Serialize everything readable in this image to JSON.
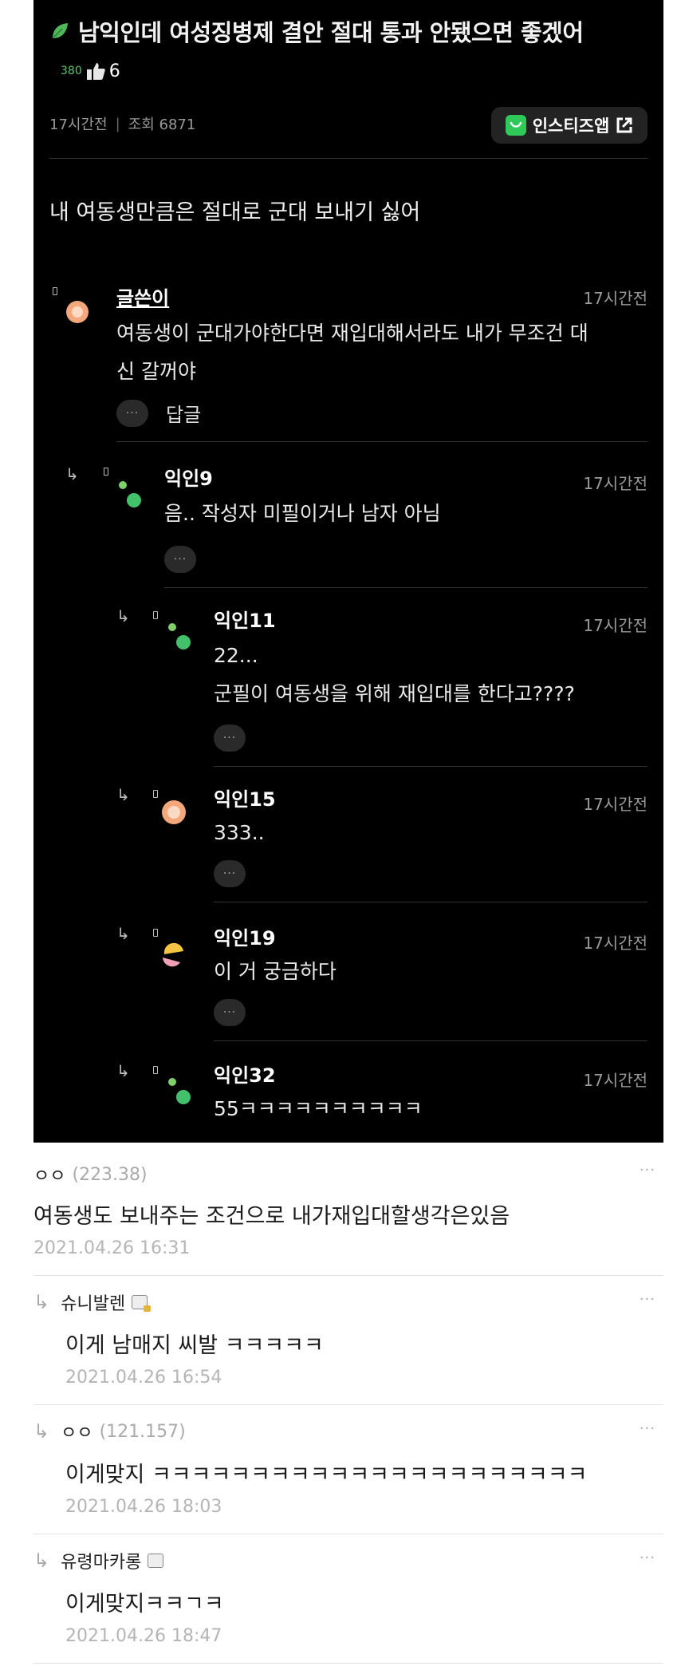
{
  "post": {
    "title": "남익인데 여성징병제 결안 절대 통과 안됐으면 좋겠어",
    "like_small": "380",
    "like_count": "6",
    "time": "17시간전",
    "views": "조회 6871",
    "app_button": "인스티즈앱",
    "body": "내 여동생만큼은 절대로 군대 보내기 싫어"
  },
  "comments": [
    {
      "name": "글쓴이",
      "time": "17시간전",
      "line1": "여동생이 군대가야한다면 재입대해서라도 내가 무조건 대",
      "line2": "신 갈꺼야",
      "reply": "답글"
    },
    {
      "name": "익인9",
      "time": "17시간전",
      "line1": "음.. 작성자 미필이거나 남자 아님"
    },
    {
      "name": "익인11",
      "time": "17시간전",
      "line1": "22...",
      "line2": "군필이 여동생을 위해 재입대를 한다고????"
    },
    {
      "name": "익인15",
      "time": "17시간전",
      "line1": "333.."
    },
    {
      "name": "익인19",
      "time": "17시간전",
      "line1": "이 거 궁금하다"
    },
    {
      "name": "익인32",
      "time": "17시간전",
      "line1": "55ㅋㅋㅋㅋㅋㅋㅋㅋㅋㅋ"
    }
  ],
  "more_dots": "···",
  "light_comments": [
    {
      "name": "ㅇㅇ",
      "ip": "(223.38)",
      "text": "여동생도 보내주는 조건으로 내가재입대할생각은있음",
      "date": "2021.04.26 16:31"
    },
    {
      "name": "슈니발렌",
      "ip": "",
      "text": "이게 남매지 씨발 ㅋㅋㅋㅋㅋ",
      "date": "2021.04.26 16:54"
    },
    {
      "name": "ㅇㅇ",
      "ip": "(121.157)",
      "text": "이게맞지 ㅋㅋㅋㅋㅋㅋㅋㅋㅋㅋㅋㅋㅋㅋㅋㅋㅋㅋㅋㅋㅋㅋ",
      "date": "2021.04.26 18:03"
    },
    {
      "name": "유령마카롱",
      "ip": "",
      "text": "이게맞지ㅋㅋㄱㅋ",
      "date": "2021.04.26 18:47"
    }
  ],
  "colors": {
    "dark_bg": "#000000",
    "app_green": "#2fc95a",
    "like_green": "#5cc46a"
  }
}
